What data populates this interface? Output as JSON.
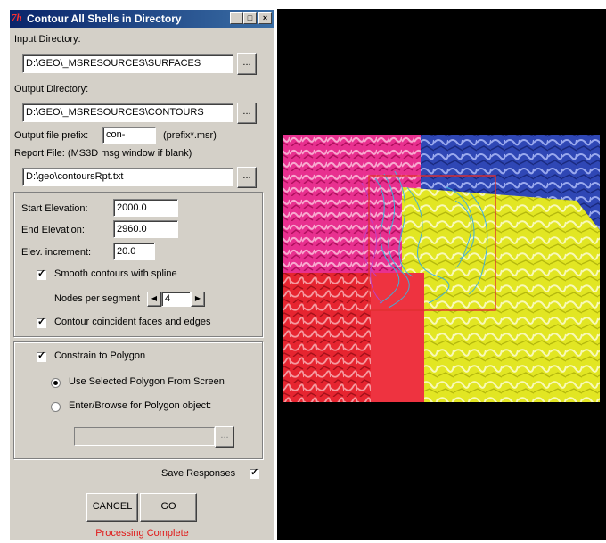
{
  "window": {
    "app_icon": "7h",
    "title": "Contour All Shells in Directory",
    "min_glyph": "_",
    "max_glyph": "□",
    "close_glyph": "×"
  },
  "input_dir": {
    "label": "Input Directory:",
    "value": "D:\\GEO\\_MSRESOURCES\\SURFACES",
    "browse": "..."
  },
  "output_dir": {
    "label": "Output Directory:",
    "value": "D:\\GEO\\_MSRESOURCES\\CONTOURS",
    "browse": "..."
  },
  "prefix": {
    "label": "Output file prefix:",
    "value": "con-",
    "hint": "(prefix*.msr)"
  },
  "report": {
    "label": "Report File:  (MS3D msg window if blank)",
    "value": "D:\\geo\\contoursRpt.txt",
    "browse": "..."
  },
  "elevation": {
    "start_label": "Start Elevation:",
    "start_value": "2000.0",
    "end_label": "End Elevation:",
    "end_value": "2960.0",
    "incr_label": "Elev. increment:",
    "incr_value": "20.0"
  },
  "smooth": {
    "label": "Smooth contours with spline",
    "checked": true
  },
  "nodes": {
    "label": "Nodes per segment",
    "value": "4"
  },
  "coincident": {
    "label": "Contour coincident faces and edges",
    "checked": true
  },
  "constrain": {
    "label": "Constrain to Polygon",
    "checked": true
  },
  "polygon_source": {
    "option_screen": "Use Selected Polygon From Screen",
    "option_browse": "Enter/Browse for Polygon object:",
    "selected": "screen",
    "browse": "..."
  },
  "save_responses": {
    "label": "Save Responses",
    "checked": true
  },
  "actions": {
    "cancel": "CANCEL",
    "go": "GO"
  },
  "status_text": "Processing Complete",
  "colors": {
    "status": "#e01818",
    "magenta_tile": "#e0177f",
    "blue_tile": "#2a3ea8",
    "red_tile": "#e2222e",
    "yellow_tile": "#e3e820",
    "selection_box": "#e03030"
  }
}
